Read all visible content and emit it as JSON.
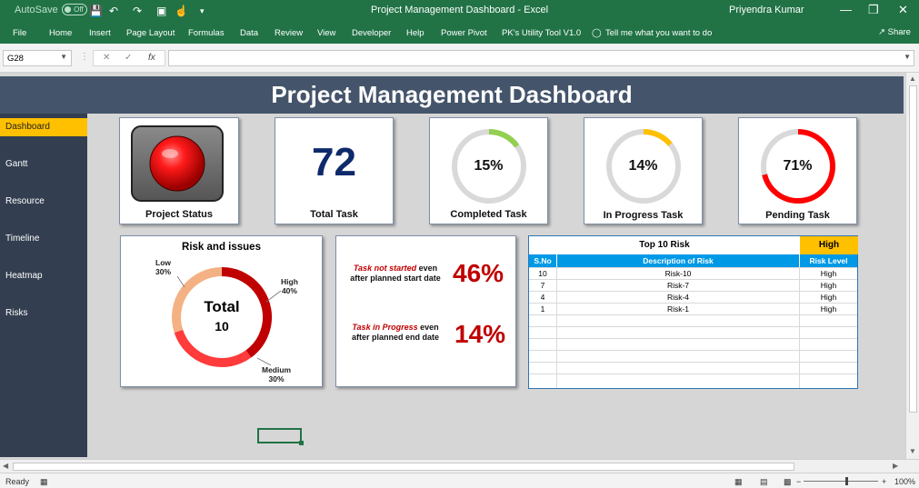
{
  "titlebar": {
    "autosave_label": "AutoSave",
    "autosave_state": "Off",
    "window_title": "Project Management Dashboard  -  Excel",
    "user_name": "Priyendra Kumar"
  },
  "ribbon": {
    "tabs": [
      "File",
      "Home",
      "Insert",
      "Page Layout",
      "Formulas",
      "Data",
      "Review",
      "View",
      "Developer",
      "Help",
      "Power Pivot",
      "PK's Utility Tool V1.0"
    ],
    "tell_me": "Tell me what you want to do",
    "share": "Share"
  },
  "formula_bar": {
    "name_box": "G28",
    "formula": ""
  },
  "dashboard": {
    "title": "Project Management Dashboard",
    "nav": [
      "Dashboard",
      "Gantt",
      "Resource",
      "Timeline",
      "Heatmap",
      "Risks"
    ],
    "active_nav": "Dashboard",
    "project_status_label": "Project Status",
    "total_task_value": "72",
    "total_task_label": "Total Task",
    "completed": {
      "pct": "15%",
      "value": 0.15,
      "label": "Completed Task",
      "color": "#92d050"
    },
    "in_progress": {
      "pct": "14%",
      "value": 0.14,
      "label": "In Progress Task",
      "color": "#ffc000"
    },
    "pending": {
      "pct": "71%",
      "value": 0.71,
      "label": "Pending Task",
      "color": "#ff0000"
    },
    "risk": {
      "title": "Risk and issues",
      "total_label": "Total",
      "total_value": "10",
      "low": {
        "name": "Low",
        "pct": "30%",
        "value": 30,
        "color": "#f4b183"
      },
      "high": {
        "name": "High",
        "pct": "40%",
        "value": 40,
        "color": "#c00000"
      },
      "medium": {
        "name": "Medium",
        "pct": "30%",
        "value": 30,
        "color": "#ff3b3b"
      }
    },
    "task_not_started": {
      "highlight": "Task not started",
      "rest1": " even",
      "rest2": "after planned start date",
      "pct": "46%"
    },
    "task_in_progress": {
      "highlight": "Task in Progress",
      "rest1": " even",
      "rest2": "after planned end date",
      "pct": "14%"
    },
    "top10": {
      "title": "Top 10 Risk",
      "filter": "High",
      "headers": [
        "S.No",
        "Description of Risk",
        "Risk Level"
      ],
      "rows": [
        [
          "10",
          "Risk-10",
          "High"
        ],
        [
          "7",
          "Risk-7",
          "High"
        ],
        [
          "4",
          "Risk-4",
          "High"
        ],
        [
          "1",
          "Risk-1",
          "High"
        ]
      ]
    }
  },
  "statusbar": {
    "ready": "Ready",
    "zoom": "100%"
  },
  "colors": {
    "excel_green": "#217346",
    "banner": "#44546a",
    "sidebar": "#333f50",
    "nav_active": "#ffc000",
    "table_header": "#0099e6"
  }
}
